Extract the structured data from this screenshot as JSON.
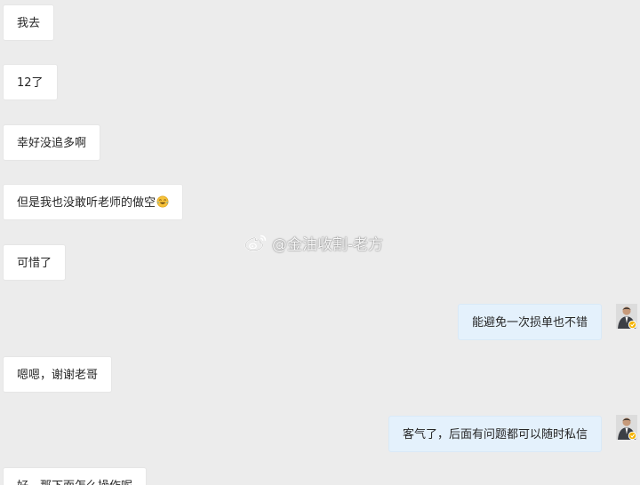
{
  "messages": [
    {
      "side": "left",
      "text": "我去"
    },
    {
      "side": "left",
      "text": "12了"
    },
    {
      "side": "left",
      "text": "幸好没追多啊"
    },
    {
      "side": "left",
      "text": "但是我也没敢听老师的做空",
      "emoji": "laugh-cry-emoji"
    },
    {
      "side": "left",
      "text": "可惜了"
    },
    {
      "side": "right",
      "text": "能避免一次损单也不错"
    },
    {
      "side": "left",
      "text": "嗯嗯，谢谢老哥"
    },
    {
      "side": "right",
      "text": "客气了，后面有问题都可以随时私信"
    },
    {
      "side": "left",
      "text": "好，那下面怎么操作呢"
    }
  ],
  "watermark": {
    "text": "@金油收割-老方",
    "icon": "weibo-icon"
  },
  "colors": {
    "background": "#ececec",
    "left_bubble": "#ffffff",
    "right_bubble": "#e4f1fc",
    "badge": "#f5b400"
  }
}
